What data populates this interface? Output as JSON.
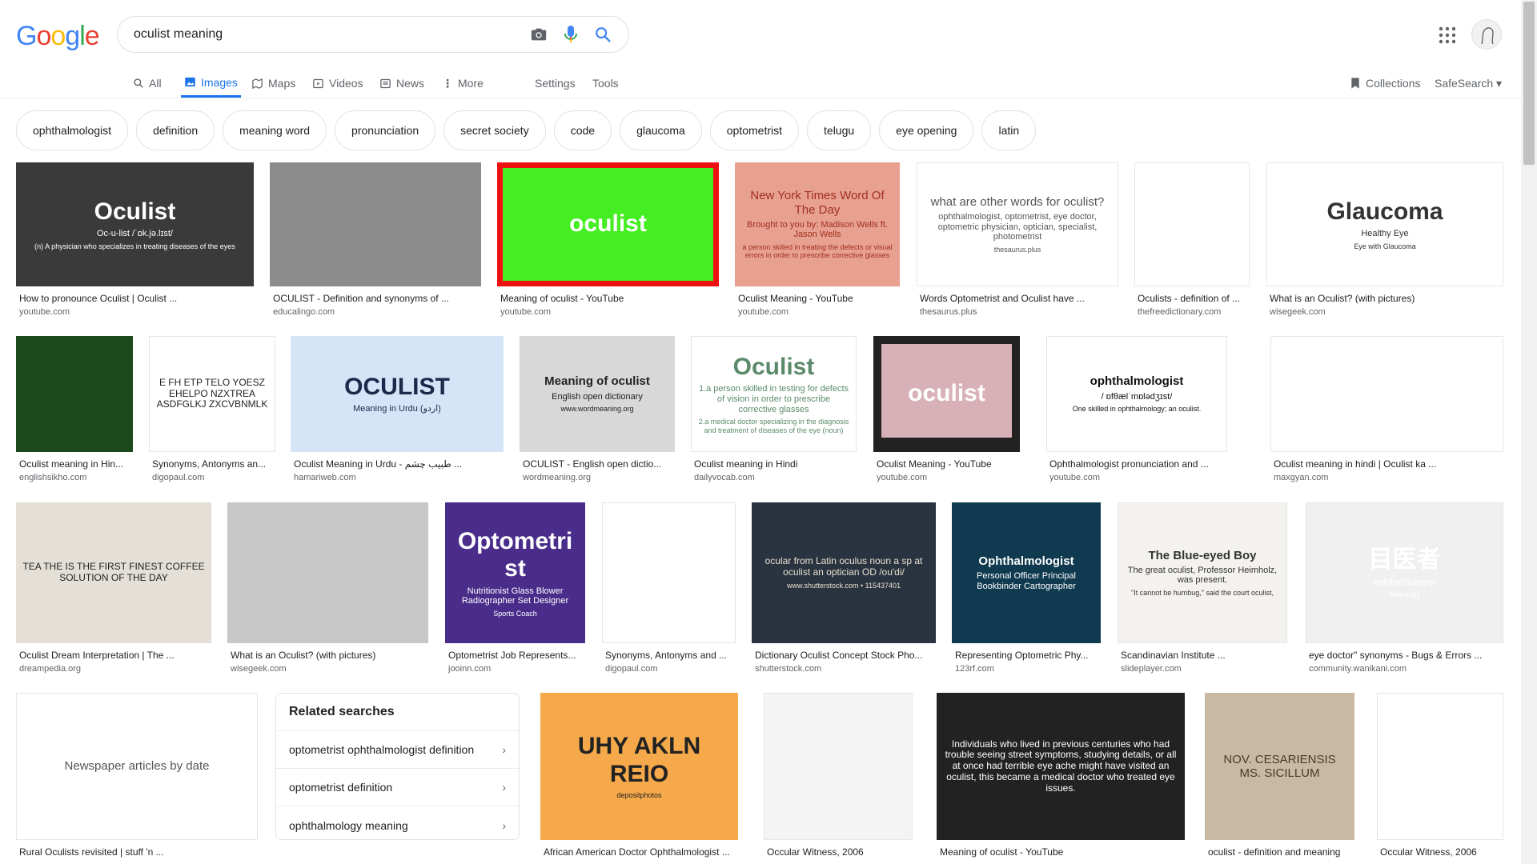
{
  "logo": {
    "letters": [
      "G",
      "o",
      "o",
      "g",
      "l",
      "e"
    ],
    "colors": [
      "#4285F4",
      "#EA4335",
      "#FBBC05",
      "#4285F4",
      "#34A853",
      "#EA4335"
    ]
  },
  "search": {
    "value": "oculist meaning"
  },
  "tabs": [
    {
      "label": "All",
      "icon": "search-icon"
    },
    {
      "label": "Images",
      "icon": "image-icon",
      "active": true
    },
    {
      "label": "Maps",
      "icon": "map-icon"
    },
    {
      "label": "Videos",
      "icon": "video-icon"
    },
    {
      "label": "News",
      "icon": "news-icon"
    },
    {
      "label": "More",
      "icon": "more-vert-icon"
    },
    {
      "label": "Settings"
    },
    {
      "label": "Tools"
    },
    {
      "label": "Collections",
      "icon": "bookmark-icon"
    },
    {
      "label": "SafeSearch ▾"
    }
  ],
  "chips": [
    "ophthalmologist",
    "definition",
    "meaning word",
    "pronunciation",
    "secret society",
    "code",
    "glaucoma",
    "optometrist",
    "telugu",
    "eye opening",
    "latin"
  ],
  "results": [
    {
      "title": "How to pronounce Oculist | Oculist ...",
      "source": "youtube.com",
      "bg": "#3a3a3a",
      "text": "Oculist",
      "fg": "#ffffff",
      "sub": "Oc-u-list  /ˈɒk.jə.lɪst/",
      "note": "(n) A physician who specializes in treating diseases of the eyes"
    },
    {
      "title": "OCULIST - Definition and synonyms of ...",
      "source": "educalingo.com",
      "bg": "#8c8c8c"
    },
    {
      "title": "Meaning of oculist - YouTube",
      "source": "youtube.com",
      "bg": "#44ee22",
      "text": "oculist",
      "fg": "#ffffff",
      "border": "#ee1111"
    },
    {
      "title": "Oculist Meaning - YouTube",
      "source": "youtube.com",
      "bg": "#e8a090",
      "text": "New York Times Word Of The Day",
      "fg": "#a03020",
      "sub": "Brought to you by: Madison Wells ft. Jason Wells",
      "note": "a person skilled in treating the defects or visual errors in order to prescribe corrective glasses"
    },
    {
      "title": "Words Optometrist and Oculist have ...",
      "source": "thesaurus.plus",
      "bg": "#ffffff",
      "text": "what are other words for oculist?",
      "fg": "#555555",
      "sub": "ophthalmologist, optometrist, eye doctor, optometric physician, optician, specialist, photometrist",
      "note": "thesaurus.plus"
    },
    {
      "title": "Oculists - definition of ...",
      "source": "thefreedictionary.com",
      "bg": "#ffffff"
    },
    {
      "title": "What is an Oculist? (with pictures)",
      "source": "wisegeek.com",
      "bg": "#ffffff",
      "text": "Glaucoma",
      "fg": "#333333",
      "sub": "Healthy Eye",
      "note": "Eye with Glaucoma"
    },
    {
      "title": "Oculist meaning in Hin...",
      "source": "englishsikho.com",
      "bg": "#1d4a1d"
    },
    {
      "title": "Synonyms, Antonyms an...",
      "source": "digopaul.com",
      "bg": "#ffffff",
      "text": "E FH ETP TELO YOESZ EHELPO NZXTREA ASDFGLKJ ZXCVBNMLK",
      "fg": "#222222"
    },
    {
      "title": "Oculist Meaning in Urdu - طبیب چشم ...",
      "source": "hamariweb.com",
      "bg": "#d6e4f7",
      "text": "OCULIST",
      "fg": "#1a2a4a",
      "sub": "Meaning in Urdu (اردو)"
    },
    {
      "title": "OCULIST - English open dictio...",
      "source": "wordmeaning.org",
      "bg": "#d8d8d8",
      "text": "Meaning of oculist",
      "fg": "#222222",
      "sub": "English open dictionary",
      "note": "www.wordmeaning.org"
    },
    {
      "title": "Oculist meaning in Hindi",
      "source": "dailyvocab.com",
      "bg": "#ffffff",
      "text": "Oculist",
      "fg": "#5a8a6a",
      "sub": "1.a person skilled in testing for defects of vision in order to prescribe corrective glasses",
      "note": "2.a medical doctor specializing in the diagnosis and treatment of diseases of the eye (noun)"
    },
    {
      "title": "Oculist Meaning - YouTube",
      "source": "youtube.com",
      "bg": "#222222",
      "text": "oculist",
      "fg": "#ffffff",
      "inner": "#d8b0b8"
    },
    {
      "title": "Ophthalmologist pronunciation and ...",
      "source": "youtube.com",
      "bg": "#ffffff",
      "text": "ophthalmologist",
      "fg": "#111111",
      "sub": "/ ɒfθælˈmɒlədʒɪst/",
      "note": "One skilled in ophthalmology; an oculist."
    },
    {
      "title": "Oculist meaning in hindi | Oculist ka ...",
      "source": "maxgyan.com",
      "bg": "#ffffff"
    },
    {
      "title": "Oculist Dream Interpretation | The ...",
      "source": "dreampedia.org",
      "bg": "#e4e0d8",
      "text": "TEA THE IS THE FIRST FINEST COFFEE SOLUTION OF THE DAY",
      "fg": "#222222"
    },
    {
      "title": "What is an Oculist? (with pictures)",
      "source": "wisegeek.com",
      "bg": "#c8c8c8"
    },
    {
      "title": "Optometrist Job Represents...",
      "source": "jooinn.com",
      "bg": "#4a2c8a",
      "text": "Optometrist",
      "fg": "#ffffff",
      "sub": "Nutritionist Glass Blower Radiographer Set Designer",
      "note": "Sports Coach"
    },
    {
      "title": "Synonyms, Antonyms and ...",
      "source": "digopaul.com",
      "bg": "#ffffff"
    },
    {
      "title": "Dictionary Oculist Concept Stock Pho...",
      "source": "shutterstock.com",
      "bg": "#2a3440",
      "text": "ocular from Latin oculus noun a sp at oculist an optician OD /ou'di/",
      "fg": "#e8e0d0",
      "note": "www.shutterstock.com • 115437401"
    },
    {
      "title": "Representing Optometric Phy...",
      "source": "123rf.com",
      "bg": "#0f3a50",
      "text": "Ophthalmologist",
      "fg": "#ffffff",
      "sub": "Personal Officer  Principal  Bookbinder  Cartographer"
    },
    {
      "title": "Scandinavian Institute ...",
      "source": "slideplayer.com",
      "bg": "#f4f2ee",
      "text": "The Blue-eyed Boy",
      "fg": "#333333",
      "sub": "The great oculist, Professor Heimholz, was present.",
      "note": "\"It cannot be humbug,\" said the court oculist,"
    },
    {
      "title": "eye doctor\" synonyms - Bugs & Errors ...",
      "source": "community.wanikani.com",
      "bg": "#f0f0f0",
      "text": "目医者",
      "fg": "#ffffff",
      "sub": "ophthalmologist",
      "note": "Meanings"
    },
    {
      "title": "Rural Oculists revisited | stuff 'n ...",
      "source": "",
      "bg": "#ffffff",
      "text": "Newspaper articles by date",
      "fg": "#555555"
    },
    {
      "title": "African American Doctor Ophthalmologist ...",
      "source": "",
      "bg": "#f5a94a",
      "text": "UHY AKLN REIO",
      "fg": "#222222",
      "note": "depositphotos"
    },
    {
      "title": "Occular Witness, 2006",
      "source": "",
      "bg": "#f4f4f4"
    },
    {
      "title": "Meaning of oculist - YouTube",
      "source": "",
      "bg": "#222222",
      "text": "Individuals who lived in previous centuries who had trouble seeing street symptoms, studying details, or all at once had terrible eye ache might have visited an oculist, this became a medical doctor who treated eye issues.",
      "fg": "#ffffff"
    },
    {
      "title": "oculist - definition and meaning",
      "source": "",
      "bg": "#c9b9a3",
      "text": "NOV. CESARIENSIS MS. SICILLUM",
      "fg": "#4a3a28"
    },
    {
      "title": "Occular Witness, 2006",
      "source": "",
      "bg": "#ffffff"
    }
  ],
  "related": {
    "heading": "Related searches",
    "items": [
      "optometrist ophthalmologist definition",
      "optometrist definition",
      "ophthalmology meaning"
    ]
  }
}
